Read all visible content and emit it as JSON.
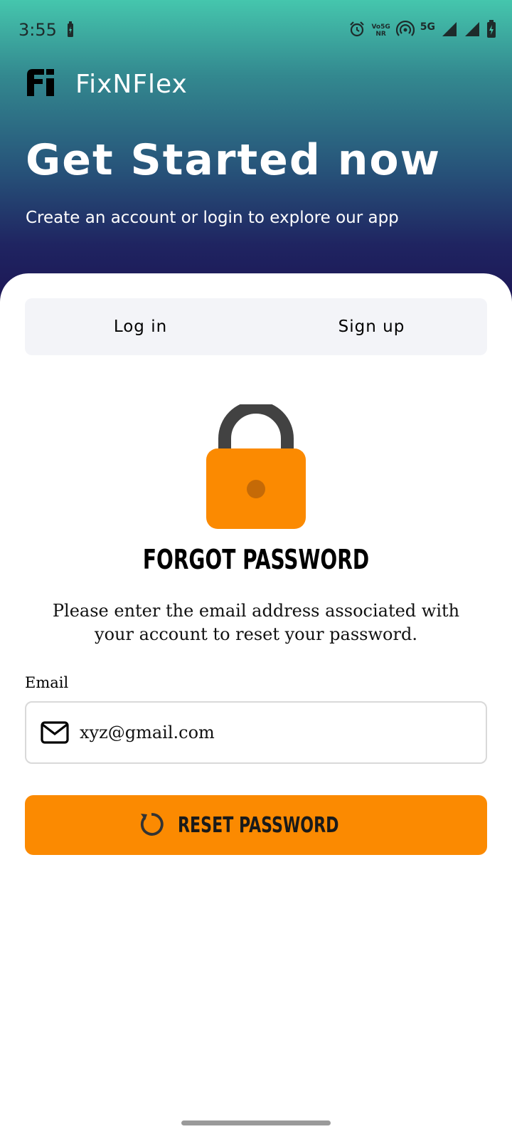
{
  "status_bar": {
    "time": "3:55",
    "network": "5G",
    "vonr": "Vo5G NR",
    "icons": [
      "battery-saver-icon",
      "alarm-icon",
      "hotspot-icon",
      "signal-icon",
      "signal-icon",
      "battery-icon"
    ]
  },
  "brand": {
    "name": "FixNFlex",
    "logo_icon": "fixnflex-logo-icon"
  },
  "hero": {
    "title": "Get Started now",
    "subtitle": "Create an account or login to explore our app"
  },
  "tabs": [
    {
      "label": "Log in"
    },
    {
      "label": "Sign up"
    }
  ],
  "forgot": {
    "icon": "lock-icon",
    "title": "FORGOT PASSWORD",
    "description": "Please enter the email address associated with your account to reset your password."
  },
  "email": {
    "label": "Email",
    "value": "xyz@gmail.com",
    "icon": "mail-icon"
  },
  "reset_button": {
    "label": "RESET PASSWORD",
    "icon": "refresh-icon"
  },
  "colors": {
    "accent": "#fb8a01",
    "gradient_top": "#45c6ad",
    "gradient_bottom": "#1d1655",
    "tab_background": "#f3f4f8"
  }
}
